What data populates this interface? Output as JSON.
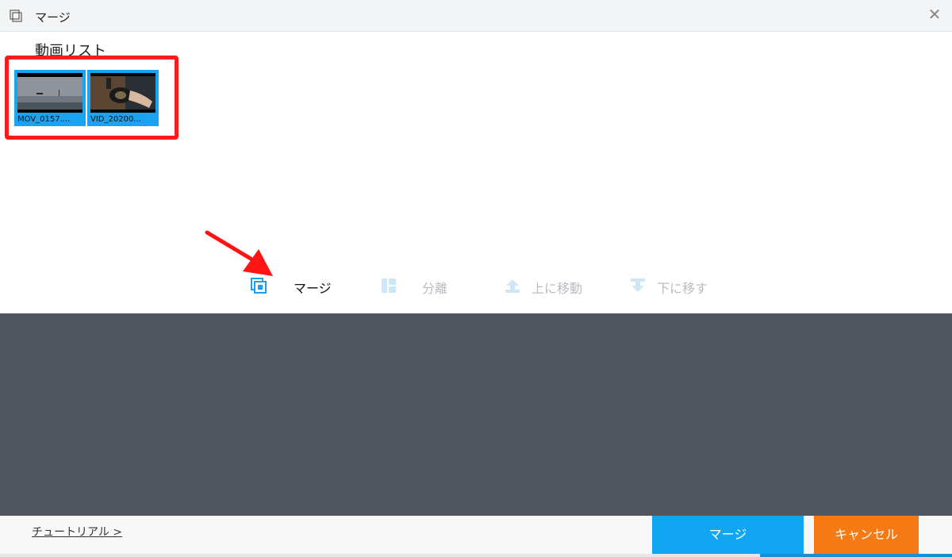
{
  "window": {
    "title": "マージ",
    "close_symbol": "✕"
  },
  "video_list": {
    "heading": "動画リスト",
    "items": [
      {
        "caption": "MOV_0157....",
        "thumbnail": "overcast-seaside-scene"
      },
      {
        "caption": "VID_20200...",
        "thumbnail": "hands-with-cup-scene"
      }
    ]
  },
  "toolbar": {
    "merge": {
      "label": "マージ",
      "state": "enabled",
      "icon": "merge-icon"
    },
    "split": {
      "label": "分離",
      "state": "disabled",
      "icon": "split-icon"
    },
    "move_up": {
      "label": "上に移動",
      "state": "disabled",
      "icon": "move-up-icon"
    },
    "move_down": {
      "label": "下に移す",
      "state": "disabled",
      "icon": "move-down-icon"
    }
  },
  "footer": {
    "tutorial_link": "チュートリアル >",
    "merge_button": "マージ",
    "cancel_button": "キャンセル"
  },
  "colors": {
    "accent_blue": "#12a6f2",
    "cancel_orange": "#f57a16",
    "highlight_red": "#ff1a1a",
    "preview_bg": "#51555d"
  }
}
